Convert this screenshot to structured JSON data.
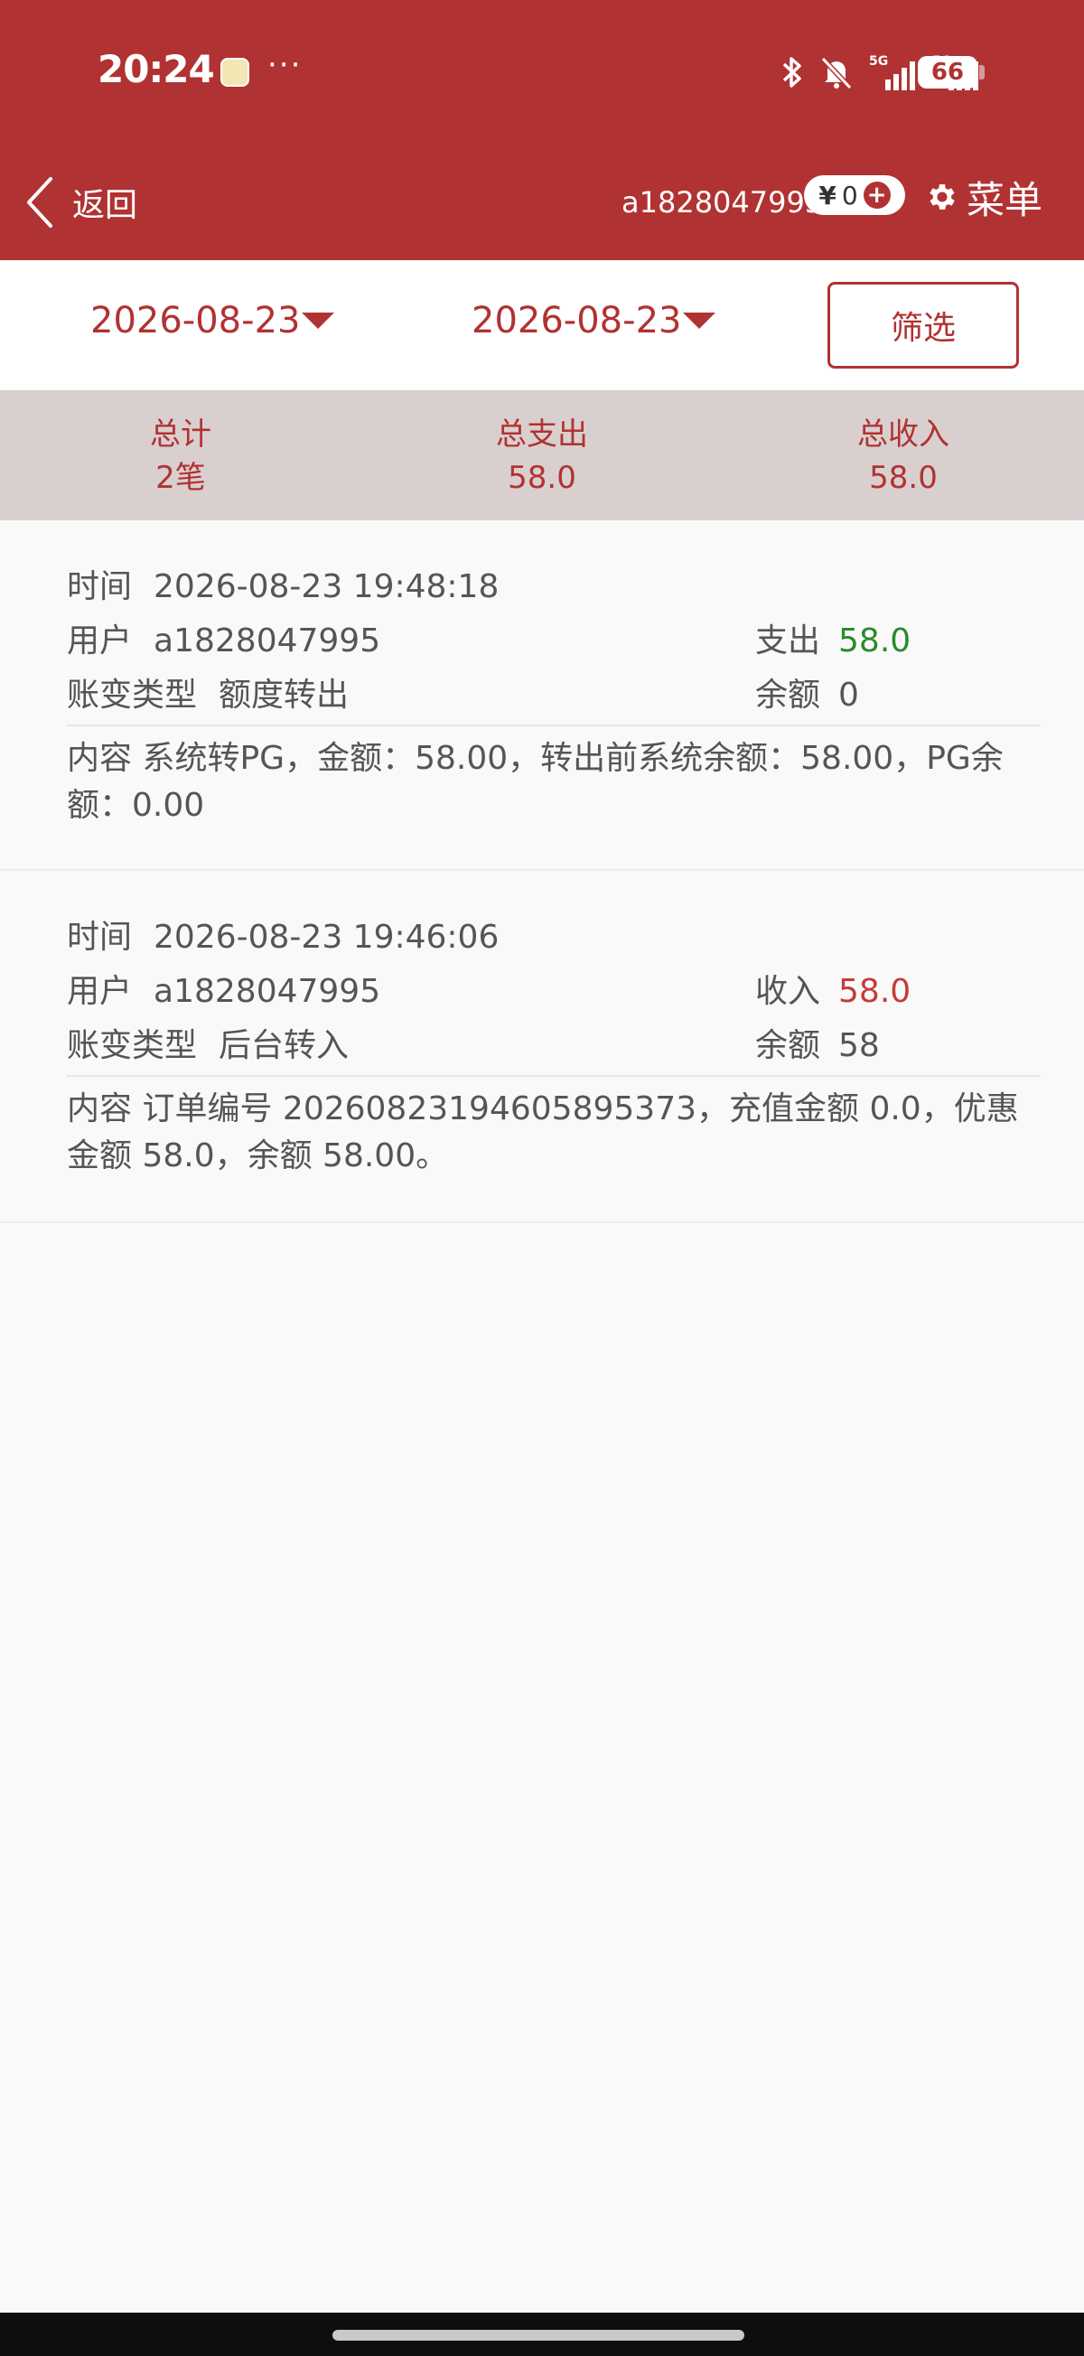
{
  "status_bar": {
    "time": "20:24",
    "battery": "66",
    "icons": [
      "app-notification-icon",
      "more-dots-icon",
      "bluetooth-icon",
      "bell-muted-icon",
      "signal-5g-icon",
      "signal-5g-icon",
      "battery-icon"
    ]
  },
  "nav": {
    "back_label": "返回",
    "username": "a1828047995",
    "wallet_currency": "¥",
    "wallet_amount": "0",
    "menu_label": "菜单"
  },
  "filter": {
    "start_date": "2026-08-23",
    "end_date": "2026-08-23",
    "filter_button": "筛选"
  },
  "summary": {
    "total_label": "总计",
    "total_value": "2笔",
    "expense_label": "总支出",
    "expense_value": "58.0",
    "income_label": "总收入",
    "income_value": "58.0"
  },
  "records": [
    {
      "time_label": "时间",
      "time": "2026-08-23 19:48:18",
      "user_label": "用户",
      "user": "a1828047995",
      "amount_label": "支出",
      "amount": "58.0",
      "type_label": "账变类型",
      "type": "额度转出",
      "balance_label": "余额",
      "balance": "0",
      "content_label": "内容",
      "content": "系统转PG，金额：58.00，转出前系统余额：58.00，PG余额：0.00"
    },
    {
      "time_label": "时间",
      "time": "2026-08-23 19:46:06",
      "user_label": "用户",
      "user": "a1828047995",
      "amount_label": "收入",
      "amount": "58.0",
      "type_label": "账变类型",
      "type": "后台转入",
      "balance_label": "余额",
      "balance": "58",
      "content_label": "内容",
      "content": "订单编号 20260823194605895373，充值金额 0.0，优惠金额 58.0，余额 58.00。"
    }
  ],
  "colors": {
    "brand": "#b13232",
    "expense": "#2a8a2a",
    "income": "#c63a3a",
    "summary_bg": "#d9cfcf"
  }
}
